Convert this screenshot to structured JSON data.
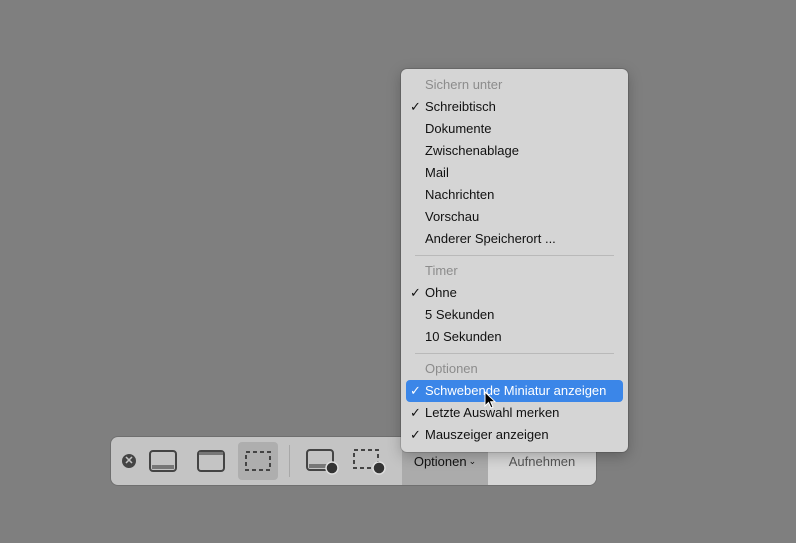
{
  "toolbar": {
    "options_label": "Optionen",
    "record_label": "Aufnehmen"
  },
  "menu": {
    "save_header": "Sichern unter",
    "save_items": [
      {
        "label": "Schreibtisch",
        "checked": true
      },
      {
        "label": "Dokumente",
        "checked": false
      },
      {
        "label": "Zwischenablage",
        "checked": false
      },
      {
        "label": "Mail",
        "checked": false
      },
      {
        "label": "Nachrichten",
        "checked": false
      },
      {
        "label": "Vorschau",
        "checked": false
      },
      {
        "label": "Anderer Speicherort ...",
        "checked": false
      }
    ],
    "timer_header": "Timer",
    "timer_items": [
      {
        "label": "Ohne",
        "checked": true
      },
      {
        "label": "5 Sekunden",
        "checked": false
      },
      {
        "label": "10 Sekunden",
        "checked": false
      }
    ],
    "options_header": "Optionen",
    "options_items": [
      {
        "label": "Schwebende Miniatur anzeigen",
        "checked": true
      },
      {
        "label": "Letzte Auswahl merken",
        "checked": true
      },
      {
        "label": "Mauszeiger anzeigen",
        "checked": true
      }
    ],
    "check": "✓",
    "highlight_color": "#3b86e8"
  }
}
